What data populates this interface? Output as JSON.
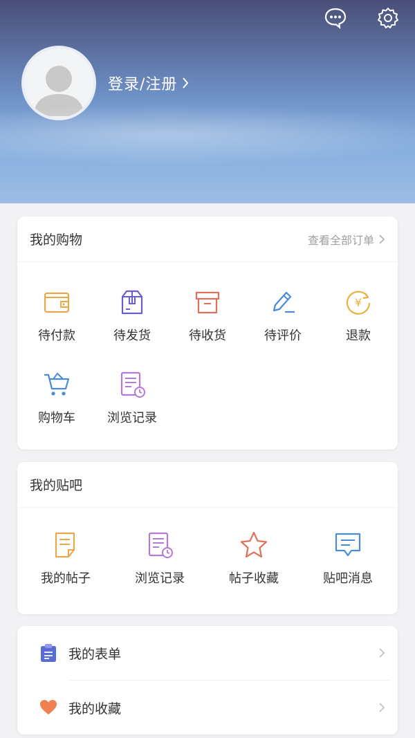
{
  "header": {
    "login_label": "登录/注册",
    "icons": [
      "chat-icon",
      "gear-icon"
    ]
  },
  "shopping": {
    "title": "我的购物",
    "view_all": "查看全部订单",
    "items": [
      {
        "label": "待付款",
        "icon": "wallet-icon",
        "color": "#e9a84a"
      },
      {
        "label": "待发货",
        "icon": "package-icon",
        "color": "#6a5fc9"
      },
      {
        "label": "待收货",
        "icon": "box-icon",
        "color": "#e0705a"
      },
      {
        "label": "待评价",
        "icon": "pen-icon",
        "color": "#4a8ad8"
      },
      {
        "label": "退款",
        "icon": "refund-icon",
        "color": "#e9b03a"
      },
      {
        "label": "购物车",
        "icon": "cart-icon",
        "color": "#4a8ad8"
      },
      {
        "label": "浏览记录",
        "icon": "history-icon",
        "color": "#b27ad8"
      }
    ]
  },
  "tieba": {
    "title": "我的贴吧",
    "items": [
      {
        "label": "我的帖子",
        "icon": "post-icon",
        "color": "#e9a84a"
      },
      {
        "label": "浏览记录",
        "icon": "history-icon",
        "color": "#b27ad8"
      },
      {
        "label": "帖子收藏",
        "icon": "star-icon",
        "color": "#e0705a"
      },
      {
        "label": "贴吧消息",
        "icon": "message-icon",
        "color": "#4a8ad8"
      }
    ]
  },
  "list": {
    "items": [
      {
        "label": "我的表单",
        "icon": "clipboard-icon",
        "color": "#5b6bd6"
      },
      {
        "label": "我的收藏",
        "icon": "heart-icon",
        "color": "#f08050"
      }
    ]
  }
}
